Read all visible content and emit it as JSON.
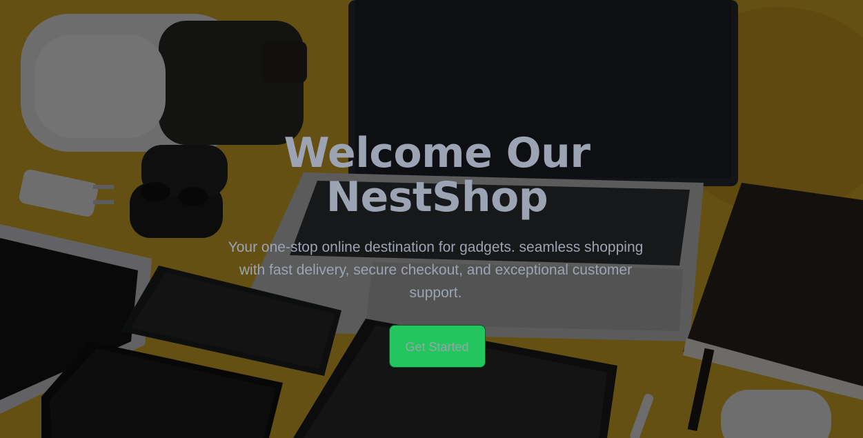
{
  "hero": {
    "title": "Welcome Our NestShop",
    "subtitle": "Your one-stop online destination for gadgets. seamless shopping with fast delivery, secure checkout, and exceptional customer support.",
    "cta_label": "Get Started"
  },
  "colors": {
    "background_yellow": "#e3b32a",
    "overlay": "rgba(0,0,0,0.55)",
    "text": "#9ca3b3",
    "cta_green": "#22c55e"
  }
}
